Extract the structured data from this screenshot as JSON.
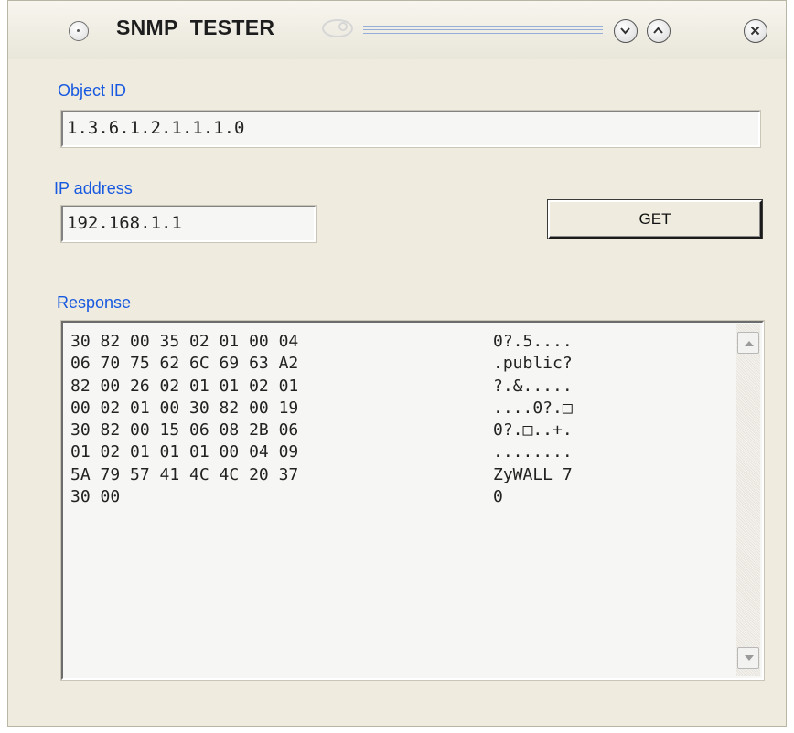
{
  "window": {
    "title": "SNMP_TESTER",
    "icons": [
      "window-menu-icon",
      "logo-icon",
      "minimize-icon",
      "maximize-icon",
      "close-icon"
    ]
  },
  "form": {
    "object_id_label": "Object ID",
    "object_id_value": "1.3.6.1.2.1.1.1.0",
    "ip_label": "IP address",
    "ip_value": "192.168.1.1",
    "get_button": "GET",
    "response_label": "Response"
  },
  "response": {
    "rows": [
      {
        "hex": "30 82 00 35 02 01 00 04",
        "ascii": "0?.5...."
      },
      {
        "hex": "06 70 75 62 6C 69 63 A2",
        "ascii": ".public?"
      },
      {
        "hex": "82 00 26 02 01 01 02 01",
        "ascii": "?.&....."
      },
      {
        "hex": "00 02 01 00 30 82 00 19",
        "ascii": "....0?.□"
      },
      {
        "hex": "30 82 00 15 06 08 2B 06",
        "ascii": "0?.□..+."
      },
      {
        "hex": "01 02 01 01 01 00 04 09",
        "ascii": "........"
      },
      {
        "hex": "5A 79 57 41 4C 4C 20 37",
        "ascii": "ZyWALL 7"
      },
      {
        "hex": "30 00",
        "ascii": "0"
      }
    ]
  },
  "colors": {
    "window_bg": "#efebde",
    "label_blue": "#1759e0",
    "field_bg": "#f6f6f4"
  }
}
